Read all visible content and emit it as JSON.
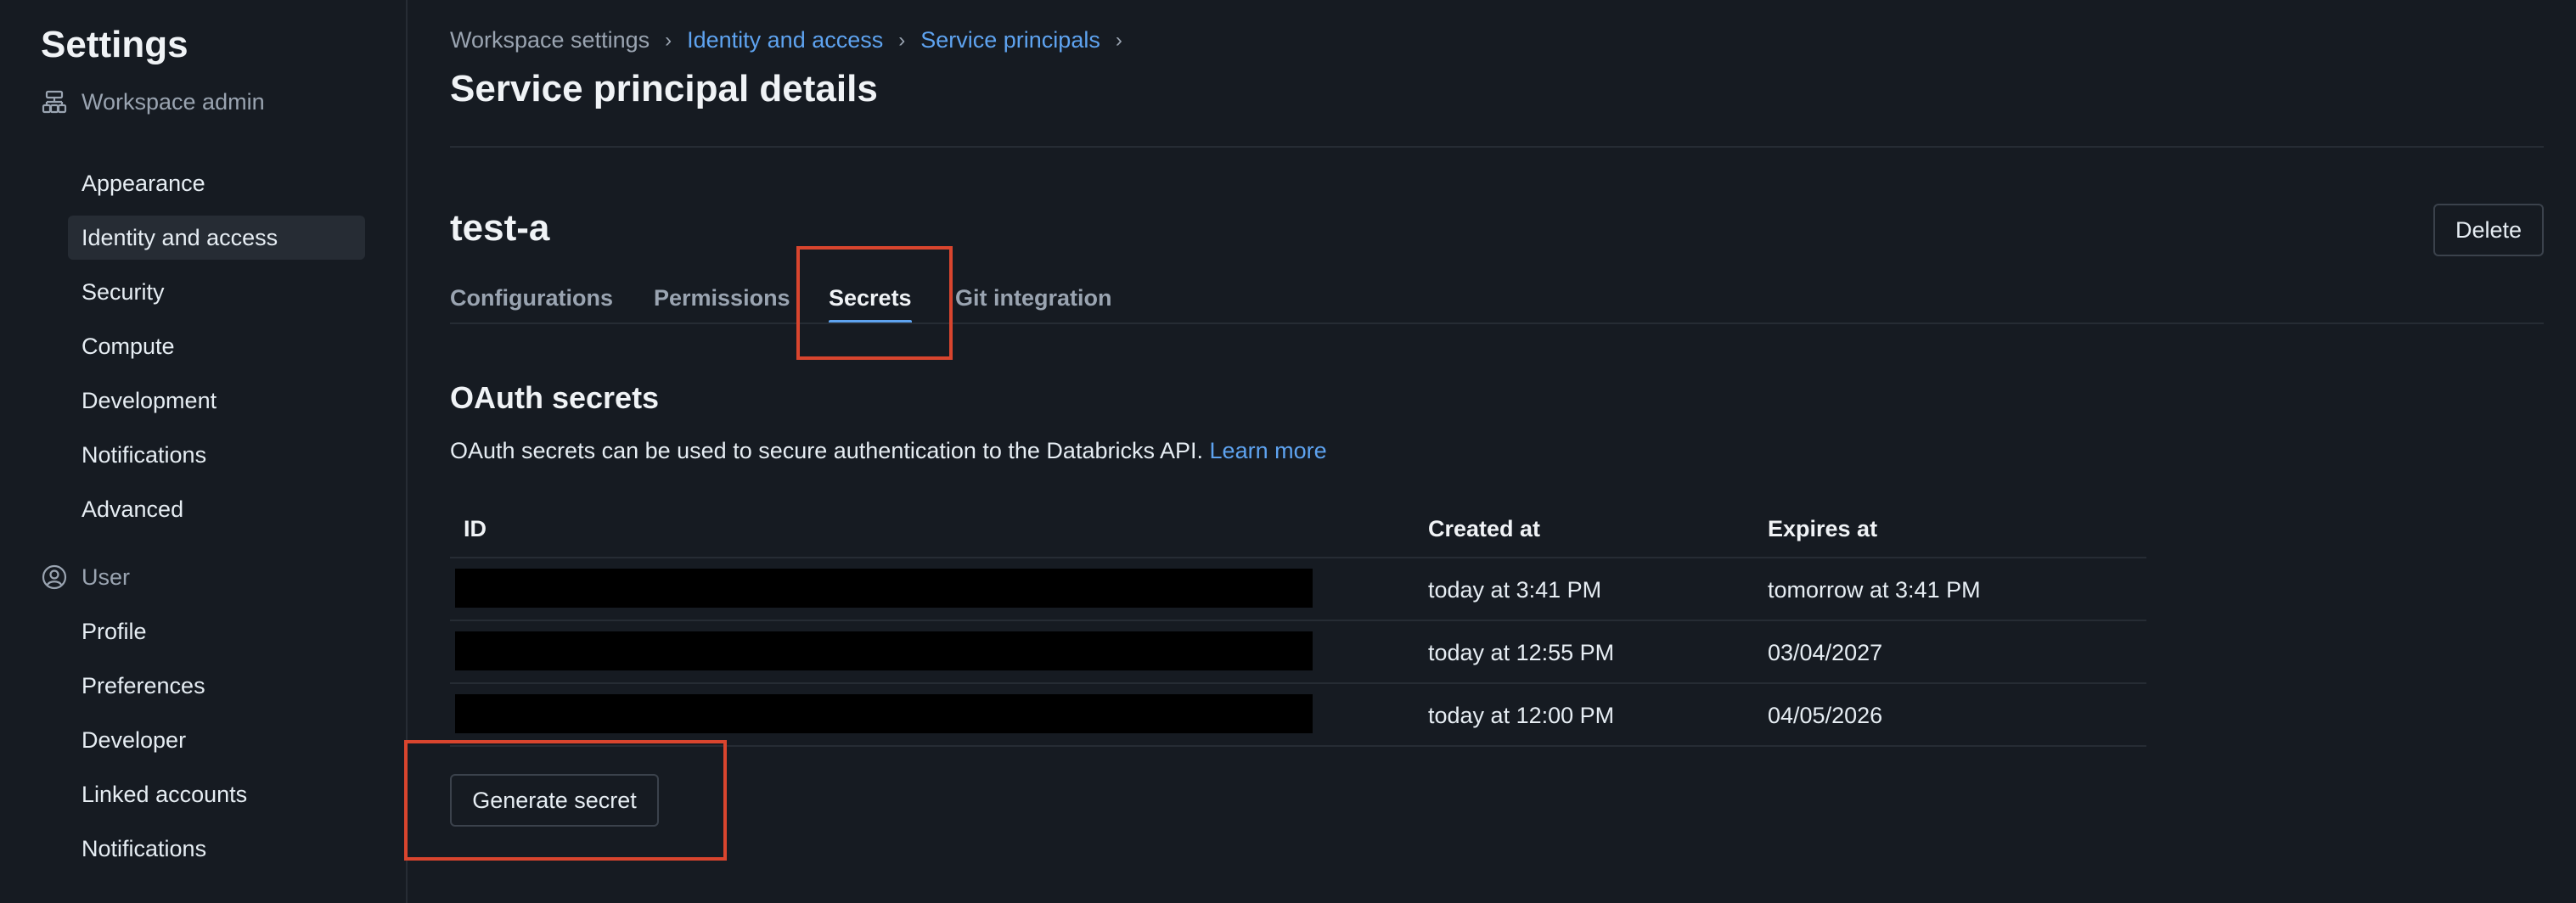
{
  "sidebar": {
    "title": "Settings",
    "groups": [
      {
        "header": "Workspace admin",
        "icon": "workspace-admin-icon",
        "items": [
          {
            "label": "Appearance"
          },
          {
            "label": "Identity and access",
            "active": true
          },
          {
            "label": "Security"
          },
          {
            "label": "Compute"
          },
          {
            "label": "Development"
          },
          {
            "label": "Notifications"
          },
          {
            "label": "Advanced"
          }
        ]
      },
      {
        "header": "User",
        "icon": "user-circle-icon",
        "items": [
          {
            "label": "Profile"
          },
          {
            "label": "Preferences"
          },
          {
            "label": "Developer"
          },
          {
            "label": "Linked accounts"
          },
          {
            "label": "Notifications"
          }
        ]
      }
    ]
  },
  "breadcrumb": {
    "items": [
      "Workspace settings",
      "Identity and access",
      "Service principals"
    ],
    "separator": "›"
  },
  "page": {
    "title": "Service principal details",
    "entity_name": "test-a",
    "delete_label": "Delete"
  },
  "tabs": [
    {
      "label": "Configurations"
    },
    {
      "label": "Permissions"
    },
    {
      "label": "Secrets",
      "active": true
    },
    {
      "label": "Git integration"
    }
  ],
  "oauth": {
    "title": "OAuth secrets",
    "description": "OAuth secrets can be used to secure authentication to the Databricks API.",
    "learn_more": "Learn more",
    "columns": [
      "ID",
      "Created at",
      "Expires at"
    ],
    "rows": [
      {
        "id": "",
        "created": "today at 3:41 PM",
        "expires": "tomorrow at 3:41 PM"
      },
      {
        "id": "",
        "created": "today at 12:55 PM",
        "expires": "03/04/2027"
      },
      {
        "id": "",
        "created": "today at 12:00 PM",
        "expires": "04/05/2026"
      }
    ],
    "generate_label": "Generate secret"
  },
  "colors": {
    "background": "#161b22",
    "accent": "#5ea3f0",
    "annotation": "#d9452e"
  }
}
